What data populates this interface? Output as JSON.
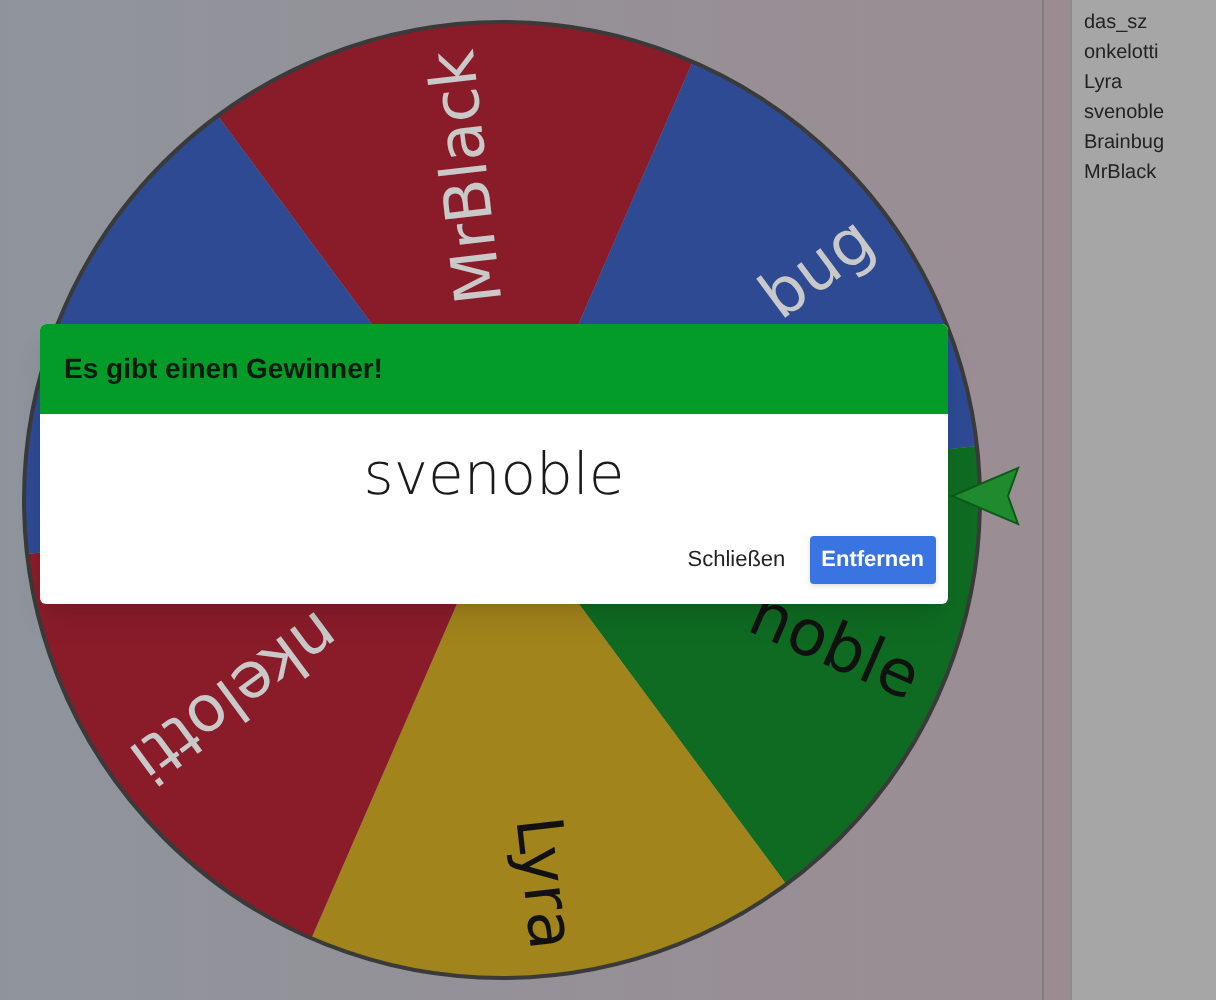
{
  "wheel": {
    "segments": [
      {
        "label": "MrBlack",
        "color": "#8a1c2a",
        "dark_label": false
      },
      {
        "label": "bug",
        "color": "#2d4a93",
        "dark_label": false
      },
      {
        "label": "noble",
        "color": "#0f6b22",
        "dark_label": true
      },
      {
        "label": "Lyra",
        "color": "#a1841b",
        "dark_label": true
      },
      {
        "label": "nkelotti",
        "color": "#8a1c2a",
        "dark_label": false
      },
      {
        "color": "#2d4a93"
      }
    ]
  },
  "dialog": {
    "title": "Es gibt einen Gewinner!",
    "winner": "svenoble",
    "buttons": [
      {
        "label": "Schließen",
        "kind": "text"
      },
      {
        "label": "Entfernen",
        "kind": "primary"
      }
    ]
  },
  "entries": [
    "das_sz",
    "onkelotti",
    "Lyra",
    "svenoble",
    "Brainbug",
    "MrBlack"
  ]
}
